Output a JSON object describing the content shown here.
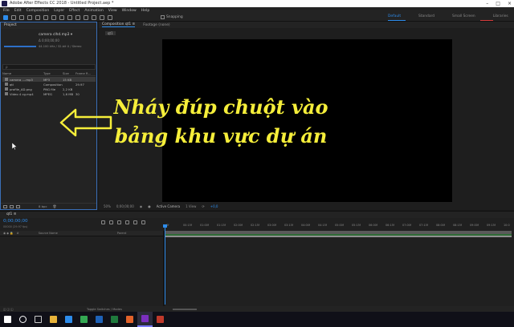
{
  "window": {
    "title": "Adobe After Effects CC 2018 - Untitled Project.aep *"
  },
  "menu": [
    "File",
    "Edit",
    "Composition",
    "Layer",
    "Effect",
    "Animation",
    "View",
    "Window",
    "Help"
  ],
  "toolbar": {
    "snapping": "Snapping",
    "workspaces": [
      "Default",
      "Standard",
      "Small Screen",
      "Libraries"
    ]
  },
  "project": {
    "tab": "Project",
    "preview_name": "camera clhd.mp3 ▾",
    "preview_duration": "Δ 0;00;00;00",
    "preview_meta": "44.100 kHz / 32-bit U / Stereo",
    "search_placeholder": "ρ",
    "columns": [
      "Name",
      "",
      "Type",
      "Size",
      "Frame R..."
    ],
    "items": [
      {
        "name": "camera ....mp3",
        "type": "MP3",
        "size": "15 KB",
        "fps": ""
      },
      {
        "name": "qti",
        "type": "Composition",
        "size": "",
        "fps": "29.97"
      },
      {
        "name": "profile_AD.png",
        "type": "PNG file",
        "size": "2,2 KB",
        "fps": ""
      },
      {
        "name": "Video 4 cg.mp4",
        "type": "MPEG",
        "size": "1,6 MB",
        "fps": "30"
      }
    ],
    "footer_bpc": "8 bpc"
  },
  "composition": {
    "tabs": [
      "Composition  qt1 ≡",
      "Footage  (none)"
    ],
    "subtab": "qt1",
    "footer": {
      "zoom": "50%",
      "timecode": "0;00;00;00",
      "camera": "Active Camera",
      "views": "1 View",
      "exposure": "+0,0"
    }
  },
  "overlay": {
    "line1": "Nháy đúp chuột vào",
    "line2": "bảng khu vực dự án"
  },
  "timeline": {
    "tab": "qt1 ≡",
    "timecode": "0;00;00;00",
    "timecode_sub": "00000 (29.97 fps)",
    "layer_header": "Source Name",
    "parent_header": "Parent",
    "ruler": [
      "0f",
      "00:15f",
      "01:00f",
      "01:15f",
      "02:00f",
      "02:15f",
      "03:00f",
      "03:15f",
      "04:00f",
      "04:15f",
      "05:00f",
      "05:15f",
      "06:00f",
      "06:15f",
      "07:00f",
      "07:15f",
      "08:00f",
      "08:15f",
      "09:00f",
      "09:15f",
      "10:0"
    ],
    "footer_toggle": "Toggle Switches / Modes"
  },
  "taskbar": {
    "apps": [
      "windows",
      "search",
      "task-view",
      "explorer",
      "store",
      "chrome",
      "photoshop",
      "excel",
      "firefox",
      "after-effects",
      "media-encoder"
    ],
    "colors": [
      "#ffffff",
      "#ffffff",
      "#cccccc",
      "#e8b33a",
      "#2d8ceb",
      "#34a853",
      "#1e62b8",
      "#1f7a3d",
      "#e2622a",
      "#7b2fbf",
      "#c0392b"
    ]
  }
}
